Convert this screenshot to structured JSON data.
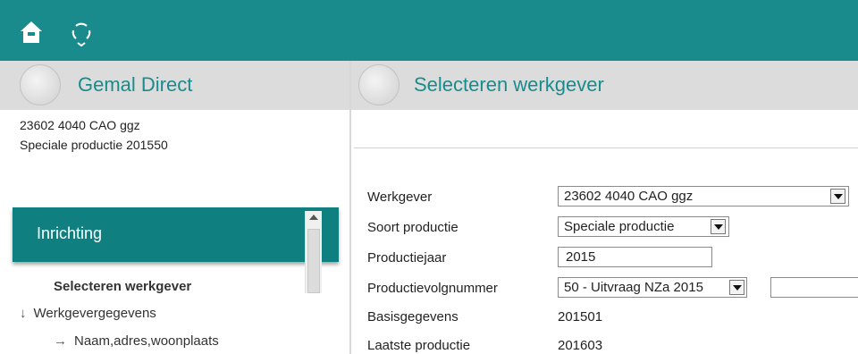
{
  "topbar": {
    "color": "#1a8b8d",
    "icons": [
      "home-icon",
      "sync-icon"
    ]
  },
  "left": {
    "header_title": "Gemal Direct",
    "info_line1": "23602 4040 CAO ggz",
    "info_line2": "Speciale productie  201550",
    "section_label": "Inrichting",
    "nav": [
      {
        "label": "Selecteren werkgever",
        "active": true
      },
      {
        "label": "Werkgevergegevens",
        "arrow": "↓"
      },
      {
        "label": "Naam,adres,woonplaats",
        "arrow": "→"
      }
    ]
  },
  "right": {
    "header_title": "Selecteren werkgever",
    "fields": {
      "werkgever": {
        "label": "Werkgever",
        "value": "23602 4040 CAO ggz"
      },
      "soort": {
        "label": "Soort productie",
        "value": "Speciale productie"
      },
      "jaar": {
        "label": "Productiejaar",
        "value": "2015"
      },
      "volgnummer": {
        "label": "Productievolgnummer",
        "value": "50 - Uitvraag NZa 2015",
        "extra_value": ""
      },
      "basis": {
        "label": "Basisgegevens",
        "value": "201501"
      },
      "laatste": {
        "label": "Laatste productie",
        "value": "201603"
      }
    }
  },
  "colors": {
    "accent": "#1a8b8d",
    "section": "#0f7f80",
    "header_bg": "#dcdcdc"
  }
}
